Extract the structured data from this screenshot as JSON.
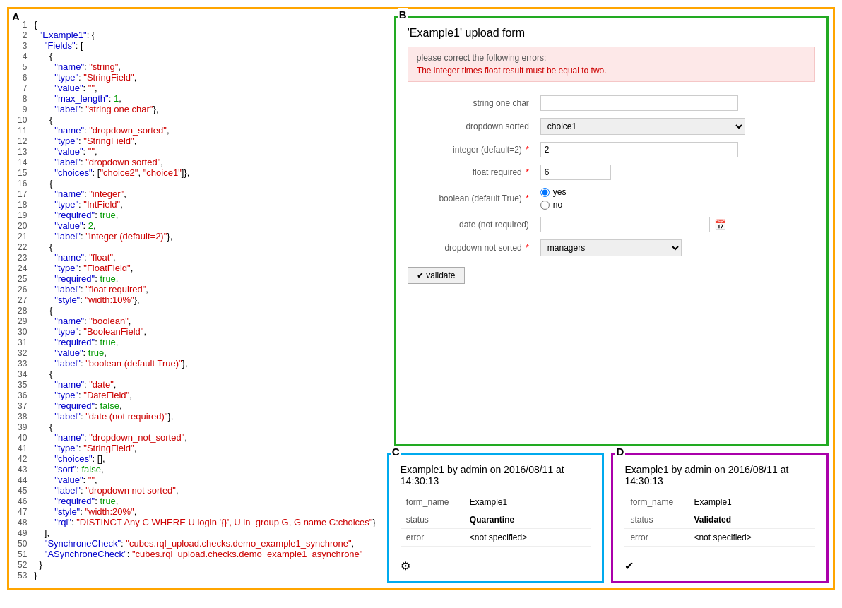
{
  "labels": {
    "a": "A",
    "b": "B",
    "c": "C",
    "d": "D"
  },
  "code": {
    "lines": [
      {
        "num": 1,
        "text": "{"
      },
      {
        "num": 2,
        "indent": "  ",
        "key": "\"Example1\"",
        "sep": ": {"
      },
      {
        "num": 3,
        "indent": "    ",
        "key": "\"Fields\"",
        "sep": ": ["
      },
      {
        "num": 4,
        "indent": "      ",
        "text": "{"
      },
      {
        "num": 5,
        "indent": "        ",
        "key": "\"name\"",
        "sep": ": ",
        "val": "\"string\"",
        "end": ","
      },
      {
        "num": 6,
        "indent": "        ",
        "key": "\"type\"",
        "sep": ": ",
        "val": "\"StringField\"",
        "end": ","
      },
      {
        "num": 7,
        "indent": "        ",
        "key": "\"value\"",
        "sep": ": ",
        "val": "\"\"",
        "end": ","
      },
      {
        "num": 8,
        "indent": "        ",
        "key": "\"max_length\"",
        "sep": ": ",
        "val": "1",
        "end": ","
      },
      {
        "num": 9,
        "indent": "        ",
        "key": "\"label\"",
        "sep": ": ",
        "val": "\"string one char\"",
        "end": "},"
      },
      {
        "num": 10,
        "indent": "      ",
        "text": "{"
      },
      {
        "num": 11,
        "indent": "        ",
        "key": "\"name\"",
        "sep": ": ",
        "val": "\"dropdown_sorted\"",
        "end": ","
      },
      {
        "num": 12,
        "indent": "        ",
        "key": "\"type\"",
        "sep": ": ",
        "val": "\"StringField\"",
        "end": ","
      },
      {
        "num": 13,
        "indent": "        ",
        "key": "\"value\"",
        "sep": ": ",
        "val": "\"\"",
        "end": ","
      },
      {
        "num": 14,
        "indent": "        ",
        "key": "\"label\"",
        "sep": ": ",
        "val": "\"dropdown sorted\"",
        "end": ","
      },
      {
        "num": 15,
        "indent": "        ",
        "key": "\"choices\"",
        "sep": ": ",
        "val": "[\"choice2\", \"choice1\"]",
        "end": "},"
      },
      {
        "num": 16,
        "indent": "      ",
        "text": "{"
      },
      {
        "num": 17,
        "indent": "        ",
        "key": "\"name\"",
        "sep": ": ",
        "val": "\"integer\"",
        "end": ","
      },
      {
        "num": 18,
        "indent": "        ",
        "key": "\"type\"",
        "sep": ": ",
        "val": "\"IntField\"",
        "end": ","
      },
      {
        "num": 19,
        "indent": "        ",
        "key": "\"required\"",
        "sep": ": ",
        "val": "true",
        "end": ","
      },
      {
        "num": 20,
        "indent": "        ",
        "key": "\"value\"",
        "sep": ": ",
        "val": "2",
        "end": ","
      },
      {
        "num": 21,
        "indent": "        ",
        "key": "\"label\"",
        "sep": ": ",
        "val": "\"integer (default=2)\"",
        "end": "},"
      },
      {
        "num": 22,
        "indent": "      ",
        "text": "{"
      },
      {
        "num": 23,
        "indent": "        ",
        "key": "\"name\"",
        "sep": ": ",
        "val": "\"float\"",
        "end": ","
      },
      {
        "num": 24,
        "indent": "        ",
        "key": "\"type\"",
        "sep": ": ",
        "val": "\"FloatField\"",
        "end": ","
      },
      {
        "num": 25,
        "indent": "        ",
        "key": "\"required\"",
        "sep": ": ",
        "val": "true",
        "end": ","
      },
      {
        "num": 26,
        "indent": "        ",
        "key": "\"label\"",
        "sep": ": ",
        "val": "\"float required\"",
        "end": ","
      },
      {
        "num": 27,
        "indent": "        ",
        "key": "\"style\"",
        "sep": ": ",
        "val": "\"width:10%\"",
        "end": "},"
      },
      {
        "num": 28,
        "indent": "      ",
        "text": "{"
      },
      {
        "num": 29,
        "indent": "        ",
        "key": "\"name\"",
        "sep": ": ",
        "val": "\"boolean\"",
        "end": ","
      },
      {
        "num": 30,
        "indent": "        ",
        "key": "\"type\"",
        "sep": ": ",
        "val": "\"BooleanField\"",
        "end": ","
      },
      {
        "num": 31,
        "indent": "        ",
        "key": "\"required\"",
        "sep": ": ",
        "val": "true",
        "end": ","
      },
      {
        "num": 32,
        "indent": "        ",
        "key": "\"value\"",
        "sep": ": ",
        "val": "true",
        "end": ","
      },
      {
        "num": 33,
        "indent": "        ",
        "key": "\"label\"",
        "sep": ": ",
        "val": "\"boolean (default True)\"",
        "end": "},"
      },
      {
        "num": 34,
        "indent": "      ",
        "text": "{"
      },
      {
        "num": 35,
        "indent": "        ",
        "key": "\"name\"",
        "sep": ": ",
        "val": "\"date\"",
        "end": ","
      },
      {
        "num": 36,
        "indent": "        ",
        "key": "\"type\"",
        "sep": ": ",
        "val": "\"DateField\"",
        "end": ","
      },
      {
        "num": 37,
        "indent": "        ",
        "key": "\"required\"",
        "sep": ": ",
        "val": "false",
        "end": ","
      },
      {
        "num": 38,
        "indent": "        ",
        "key": "\"label\"",
        "sep": ": ",
        "val": "\"date (not required)\"",
        "end": "},"
      },
      {
        "num": 39,
        "indent": "      ",
        "text": "{"
      },
      {
        "num": 40,
        "indent": "        ",
        "key": "\"name\"",
        "sep": ": ",
        "val": "\"dropdown_not_sorted\"",
        "end": ","
      },
      {
        "num": 41,
        "indent": "        ",
        "key": "\"type\"",
        "sep": ": ",
        "val": "\"StringField\"",
        "end": ","
      },
      {
        "num": 42,
        "indent": "        ",
        "key": "\"choices\"",
        "sep": ": ",
        "val": "[]",
        "end": ","
      },
      {
        "num": 43,
        "indent": "        ",
        "key": "\"sort\"",
        "sep": ": ",
        "val": "false",
        "end": ","
      },
      {
        "num": 44,
        "indent": "        ",
        "key": "\"value\"",
        "sep": ": ",
        "val": "\"\"",
        "end": ","
      },
      {
        "num": 45,
        "indent": "        ",
        "key": "\"label\"",
        "sep": ": ",
        "val": "\"dropdown not sorted\"",
        "end": ","
      },
      {
        "num": 46,
        "indent": "        ",
        "key": "\"required\"",
        "sep": ": ",
        "val": "true",
        "end": ","
      },
      {
        "num": 47,
        "indent": "        ",
        "key": "\"style\"",
        "sep": ": ",
        "val": "\"width:20%\"",
        "end": ","
      },
      {
        "num": 48,
        "indent": "        ",
        "key": "\"rql\"",
        "sep": ": ",
        "val": "\"DISTINCT Any C WHERE U login '{}', U in_group G, G name C:choices\"",
        "end": "}"
      },
      {
        "num": 49,
        "text": "    ],"
      },
      {
        "num": 50,
        "indent": "    ",
        "key": "\"SynchroneCheck\"",
        "sep": ": ",
        "val": "\"cubes.rql_upload.checks.demo_example1_synchrone\"",
        "end": ","
      },
      {
        "num": 51,
        "indent": "    ",
        "key": "\"ASynchroneCheck\"",
        "sep": ": ",
        "val": "\"cubes.rql_upload.checks.demo_example1_asynchrone\""
      },
      {
        "num": 52,
        "text": "  }"
      },
      {
        "num": 53,
        "text": "}"
      }
    ]
  },
  "form": {
    "title": "'Example1' upload form",
    "error_title": "please correct the following errors:",
    "error_msg": "The integer times float result must be equal to two.",
    "fields": [
      {
        "label": "string one char",
        "type": "text",
        "value": "",
        "required": false
      },
      {
        "label": "dropdown sorted",
        "type": "select",
        "value": "choice1",
        "required": false,
        "options": [
          "choice1",
          "choice2"
        ]
      },
      {
        "label": "integer (default=2)",
        "type": "text",
        "value": "2",
        "required": true
      },
      {
        "label": "float required",
        "type": "text",
        "value": "6",
        "required": true
      },
      {
        "label": "boolean (default True)",
        "type": "radio",
        "value": "yes",
        "required": true,
        "options": [
          "yes",
          "no"
        ]
      },
      {
        "label": "date (not required)",
        "type": "date",
        "value": "",
        "required": false
      },
      {
        "label": "dropdown not sorted",
        "type": "select",
        "value": "managers",
        "required": true,
        "options": [
          "managers"
        ]
      }
    ],
    "validate_label": "✔ validate"
  },
  "record_c": {
    "title": "Example1 by admin on 2016/08/11 at 14:30:13",
    "rows": [
      {
        "field": "form_name",
        "value": "Example1"
      },
      {
        "field": "status",
        "value": "Quarantine"
      },
      {
        "field": "error",
        "value": "<not specified>"
      }
    ],
    "icon": "⚙"
  },
  "record_d": {
    "title": "Example1 by admin on 2016/08/11 at 14:30:13",
    "rows": [
      {
        "field": "form_name",
        "value": "Example1"
      },
      {
        "field": "status",
        "value": "Validated"
      },
      {
        "field": "error",
        "value": "<not specified>"
      }
    ],
    "icon": "✔"
  }
}
